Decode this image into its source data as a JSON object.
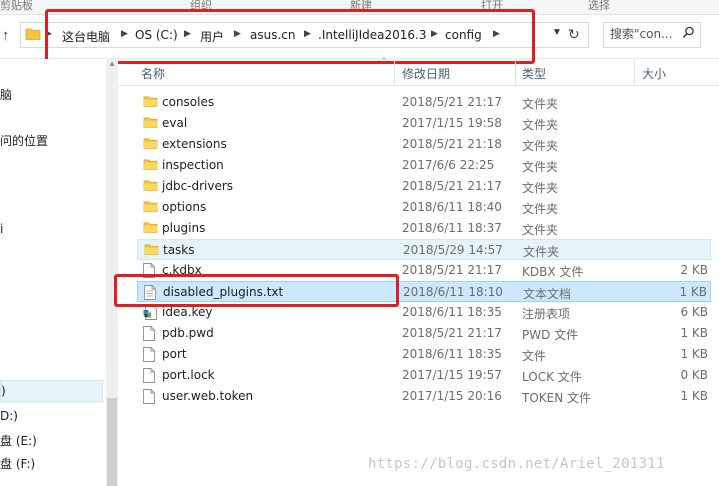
{
  "ribbon": {
    "labels": [
      "剪贴板",
      "组织",
      "新建",
      "打开",
      "选择"
    ]
  },
  "address": {
    "crumbs": [
      "这台电脑",
      "OS (C:)",
      "用户",
      "asus.cn",
      ".IntelliJIdea2016.3",
      "config"
    ],
    "dropdown_icon": "chevron-down-icon",
    "refresh_icon": "refresh-icon"
  },
  "search": {
    "placeholder": "搜索\"con...",
    "icon": "search-icon"
  },
  "nav": {
    "items": [
      "脑",
      "问的位置",
      "i",
      ")",
      "D:)",
      "盘 (E:)",
      "盘 (F:)"
    ]
  },
  "columns": {
    "name": "名称",
    "date": "修改日期",
    "type": "类型",
    "size": "大小"
  },
  "files": [
    {
      "name": "consoles",
      "date": "2018/5/21 21:17",
      "type": "文件夹",
      "size": "",
      "icon": "folder-icon",
      "state": ""
    },
    {
      "name": "eval",
      "date": "2017/1/15 19:58",
      "type": "文件夹",
      "size": "",
      "icon": "folder-icon",
      "state": ""
    },
    {
      "name": "extensions",
      "date": "2018/5/21 21:18",
      "type": "文件夹",
      "size": "",
      "icon": "folder-icon",
      "state": ""
    },
    {
      "name": "inspection",
      "date": "2017/6/6 22:25",
      "type": "文件夹",
      "size": "",
      "icon": "folder-icon",
      "state": ""
    },
    {
      "name": "jdbc-drivers",
      "date": "2018/5/21 21:17",
      "type": "文件夹",
      "size": "",
      "icon": "folder-icon",
      "state": ""
    },
    {
      "name": "options",
      "date": "2018/6/11 18:40",
      "type": "文件夹",
      "size": "",
      "icon": "folder-icon",
      "state": ""
    },
    {
      "name": "plugins",
      "date": "2018/6/11 18:37",
      "type": "文件夹",
      "size": "",
      "icon": "folder-icon",
      "state": ""
    },
    {
      "name": "tasks",
      "date": "2018/5/29 14:57",
      "type": "文件夹",
      "size": "",
      "icon": "folder-icon",
      "state": "hover"
    },
    {
      "name": "c.kdbx",
      "date": "2018/5/21 21:17",
      "type": "KDBX 文件",
      "size": "2 KB",
      "icon": "file-icon",
      "state": ""
    },
    {
      "name": "disabled_plugins.txt",
      "date": "2018/6/11 18:10",
      "type": "文本文档",
      "size": "1 KB",
      "icon": "text-file-icon",
      "state": "selected"
    },
    {
      "name": "idea.key",
      "date": "2018/6/11 18:35",
      "type": "注册表项",
      "size": "6 KB",
      "icon": "registry-file-icon",
      "state": ""
    },
    {
      "name": "pdb.pwd",
      "date": "2018/5/21 21:17",
      "type": "PWD 文件",
      "size": "1 KB",
      "icon": "file-icon",
      "state": ""
    },
    {
      "name": "port",
      "date": "2018/6/11 18:35",
      "type": "文件",
      "size": "1 KB",
      "icon": "file-icon",
      "state": ""
    },
    {
      "name": "port.lock",
      "date": "2017/1/15 19:57",
      "type": "LOCK 文件",
      "size": "0 KB",
      "icon": "file-icon",
      "state": ""
    },
    {
      "name": "user.web.token",
      "date": "2017/1/15 20:16",
      "type": "TOKEN 文件",
      "size": "1 KB",
      "icon": "file-icon",
      "state": ""
    }
  ],
  "watermark": "https://blog.csdn.net/Ariel_201311",
  "colors": {
    "highlight_red": "#e02020",
    "selection_blue": "#cce8ff",
    "hover_blue": "#e5f3fb",
    "folder_yellow": "#f5c542"
  }
}
